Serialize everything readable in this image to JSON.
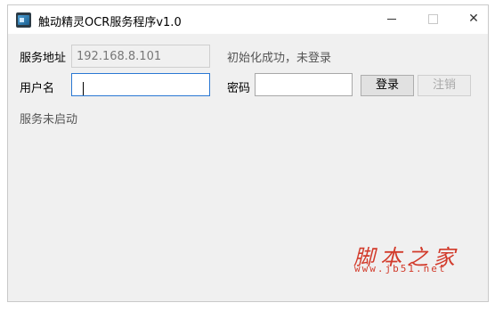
{
  "window": {
    "title": "触动精灵OCR服务程序v1.0",
    "controls": {
      "minimize": "minimize",
      "maximize": "maximize",
      "close": "✕"
    }
  },
  "form": {
    "server_label": "服务地址",
    "server_value": "192.168.8.101",
    "init_status": "初始化成功，未登录",
    "username_label": "用户名",
    "username_value": "",
    "password_label": "密码",
    "password_value": "",
    "login_button": "登录",
    "logout_button": "注销",
    "service_status": "服务未启动"
  },
  "watermark": {
    "text": "脚本之家",
    "url": "www.jb51.net"
  },
  "colors": {
    "window_bg": "#f0f0f0",
    "focus_border": "#2a78d3",
    "watermark": "#d23a2a"
  }
}
